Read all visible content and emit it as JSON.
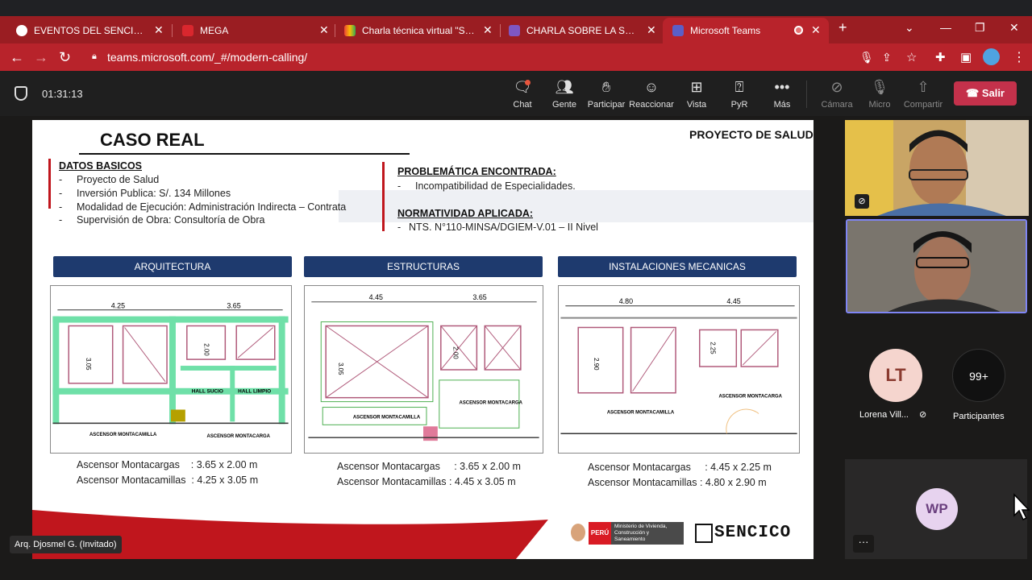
{
  "browser": {
    "tabs": [
      {
        "title": "EVENTOS DEL SENCICO",
        "close": "✕"
      },
      {
        "title": "MEGA",
        "close": "✕"
      },
      {
        "title": "Charla técnica virtual \"SUPER",
        "close": "✕"
      },
      {
        "title": "CHARLA SOBRE LA SUPERVI",
        "close": "✕"
      },
      {
        "title": "Microsoft Teams",
        "close": "✕",
        "active": true
      }
    ],
    "new_tab": "+",
    "url": "teams.microsoft.com/_#/modern-calling/"
  },
  "teams": {
    "timer": "01:31:13",
    "toolbar": [
      {
        "label": "Chat",
        "icon": "chat-icon"
      },
      {
        "label": "Gente",
        "icon": "people-icon"
      },
      {
        "label": "Participar",
        "icon": "raise-hand-icon"
      },
      {
        "label": "Reaccionar",
        "icon": "smiley-icon"
      },
      {
        "label": "Vista",
        "icon": "grid-view-icon"
      },
      {
        "label": "PyR",
        "icon": "qa-icon"
      },
      {
        "label": "Más",
        "icon": "more-icon"
      },
      {
        "label": "Cámara",
        "icon": "camera-off-icon"
      },
      {
        "label": "Micro",
        "icon": "mic-off-icon"
      },
      {
        "label": "Compartir",
        "icon": "share-icon"
      }
    ],
    "leave": "Salir",
    "presenter_tag": "Arq. Djosmel G. (Invitado)",
    "participants": {
      "lt_initials": "LT",
      "lt_name": "Lorena Vill...",
      "count": "99+",
      "count_label": "Participantes",
      "wp_initials": "WP",
      "more": "···"
    }
  },
  "slide": {
    "title": "CASO REAL",
    "project": "PROYECTO DE SALUD",
    "datos_heading": "DATOS BASICOS",
    "datos": [
      "Proyecto de Salud",
      "Inversión Publica: S/. 134 Millones",
      "Modalidad de Ejecución: Administración Indirecta – Contrata",
      "Supervisión de Obra: Consultoría de Obra"
    ],
    "problem_heading": "PROBLEMÁTICA ENCONTRADA:",
    "problem": [
      "Incompatibilidad de Especialidades."
    ],
    "norm_heading": "NORMATIVIDAD APLICADA:",
    "norm": [
      "NTS. N°110-MINSA/DGIEM-V.01 – II Nivel"
    ],
    "dash": "-",
    "panels": [
      {
        "header": "ARQUITECTURA",
        "dim_top_a": "4.25",
        "dim_top_b": "3.65",
        "dim_side_a": "3.05",
        "dim_side_b": "2.00",
        "label_a": "HALL SUCIO",
        "label_b": "HALL LIMPIO",
        "room_a": "ASCENSOR MONTACAMILLA",
        "room_b": "ASCENSOR MONTACARGA",
        "spec1_name": "Ascensor Montacargas",
        "spec1_val": ": 3.65 x 2.00 m",
        "spec2_name": "Ascensor Montacamillas",
        "spec2_val": ": 4.25 x 3.05 m"
      },
      {
        "header": "ESTRUCTURAS",
        "dim_top_a": "4.45",
        "dim_top_b": "3.65",
        "dim_side_a": "3.05",
        "dim_side_b": "2.00",
        "room_a": "ASCENSOR MONTACAMILLA",
        "room_b": "ASCENSOR MONTACARGA",
        "spec1_name": "Ascensor Montacargas",
        "spec1_val": ": 3.65 x 2.00 m",
        "spec2_name": "Ascensor Montacamillas",
        "spec2_val": ": 4.45 x 3.05 m"
      },
      {
        "header": "INSTALACIONES MECANICAS",
        "dim_top_a": "4.80",
        "dim_top_b": "4.45",
        "dim_side_a": "2.90",
        "dim_side_b": "2.25",
        "room_a": "ASCENSOR MONTACAMILLA",
        "room_b": "ASCENSOR MONTACARGA",
        "spec1_name": "Ascensor Montacargas",
        "spec1_val": ": 4.45 x 2.25 m",
        "spec2_name": "Ascensor Montacamillas",
        "spec2_val": ": 4.80 x 2.90 m"
      }
    ],
    "logo_peru": {
      "flag": "PERÚ",
      "text": "Ministerio de Vivienda, Construcción y Saneamiento"
    },
    "logo_sencico": {
      "text": "SENCICO"
    }
  },
  "colors": {
    "brand_red": "#b8232b",
    "teams_leave": "#c4314b",
    "slide_header": "#1e3a6e",
    "accent_red": "#c0161d"
  }
}
